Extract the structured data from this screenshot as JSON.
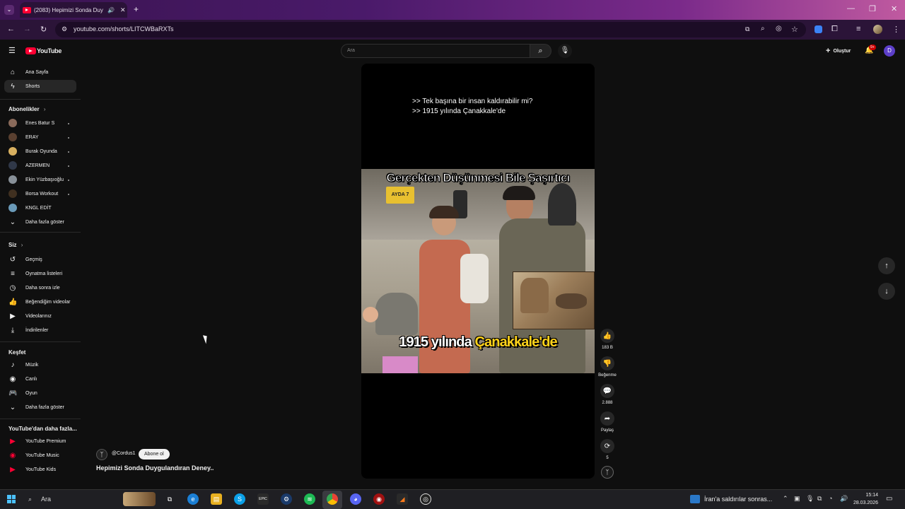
{
  "browser": {
    "tab_title": "(2083) Hepimizi Sonda Duy",
    "url": "youtube.com/shorts/LITCWBaRXTs",
    "new_tab": "+",
    "win_minimize": "—",
    "win_restore": "❐",
    "win_close": "✕"
  },
  "youtube": {
    "logo_text": "YouTube",
    "search_placeholder": "Ara",
    "create_label": "Oluştur",
    "notif_badge": "9+",
    "account_initial": "D"
  },
  "sidebar": {
    "home": "Ana Sayfa",
    "shorts": "Shorts",
    "subscriptions_title": "Abonelikler",
    "subscriptions": [
      "Enes Batur S",
      "ERAY",
      "Burak Oyunda",
      "AZERMEN",
      "Ekin Yüzbaşıoğlu",
      "Borsa Workout",
      "KNGL EDİT"
    ],
    "show_more_1": "Daha fazla göster",
    "you_title": "Siz",
    "you_items": [
      "Geçmiş",
      "Oynatma listeleri",
      "Daha sonra izle",
      "Beğendiğim videolar",
      "Videolarınız",
      "İndirilenler"
    ],
    "explore_title": "Keşfet",
    "explore_items": [
      "Müzik",
      "Canlı",
      "Oyun"
    ],
    "show_more_2": "Daha fazla göster",
    "more_title": "YouTube'dan daha fazla...",
    "more_items": [
      "YouTube Premium",
      "YouTube Music",
      "YouTube Kids"
    ]
  },
  "short": {
    "caption_line1": ">> Tek başına bir insan kaldırabilir mi?",
    "caption_line2": ">> 1915 yılında Çanakkale'de",
    "overlay_top": "Gerçekten Düşünmesi Bile Şaşırtıcı",
    "overlay_bottom_a": "1915 yılında ",
    "overlay_bottom_b": "Çanakkale'de",
    "sign_text": "AYDA 7",
    "channel": "@Cordus1",
    "subscribe": "Abone ol",
    "title": "Hepimizi Sonda Duygulandıran Deney.."
  },
  "actions": {
    "like_count": "183 B",
    "dislike_label": "Beğenme",
    "comment_count": "2.888",
    "share_label": "Paylaş",
    "remix_count": "5"
  },
  "taskbar": {
    "search_label": "Ara",
    "news_text": "İran'a saldırılar sonras...",
    "time": "15:14",
    "date": "28.03.2026",
    "epic_label": "EPIC"
  }
}
